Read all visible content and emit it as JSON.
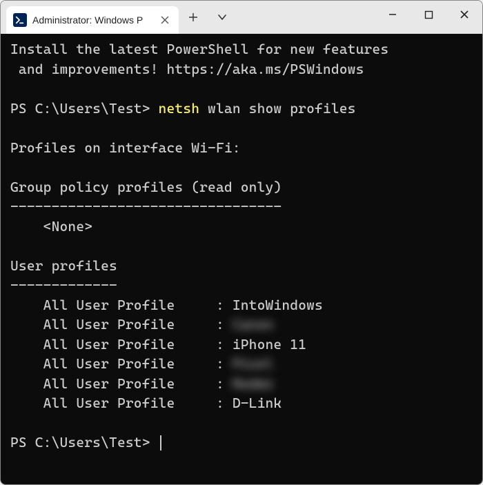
{
  "titlebar": {
    "tab_title": "Administrator: Windows P",
    "icon_name": "powershell-icon"
  },
  "terminal": {
    "banner_line1": "Install the latest PowerShell for new features",
    "banner_line2": " and improvements! https://aka.ms/PSWindows",
    "prompt1_prefix": "PS C:\\Users\\Test> ",
    "cmd_token": "netsh",
    "cmd_rest": " wlan show profiles",
    "section_interface": "Profiles on interface Wi-Fi:",
    "group_policy_header": "Group policy profiles (read only)",
    "group_policy_rule": "---------------------------------",
    "group_policy_none": "    <None>",
    "user_profiles_header": "User profiles",
    "user_profiles_rule": "-------------",
    "profile_label": "    All User Profile     : ",
    "profiles": [
      {
        "name": "IntoWindows",
        "blurred": false
      },
      {
        "name": "Canon  ",
        "blurred": true
      },
      {
        "name": "iPhone 11",
        "blurred": false
      },
      {
        "name": "Pixel  ",
        "blurred": true
      },
      {
        "name": "Redmi  ",
        "blurred": true
      },
      {
        "name": "D-Link",
        "blurred": false
      }
    ],
    "prompt2": "PS C:\\Users\\Test> "
  }
}
